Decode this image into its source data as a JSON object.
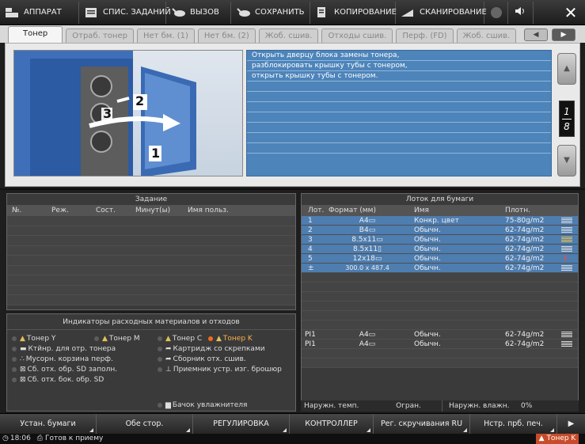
{
  "topbar": {
    "items": [
      {
        "label": "АППАРАТ",
        "icon": "machine-icon"
      },
      {
        "label": "СПИС. ЗАДАНИЙ",
        "icon": "list-icon"
      },
      {
        "label": "ВЫЗОВ",
        "icon": "recall-icon"
      },
      {
        "label": "СОХРАНИТЬ",
        "icon": "save-icon"
      },
      {
        "label": "КОПИРОВАНИЕ",
        "icon": "copy-icon"
      },
      {
        "label": "СКАНИРОВАНИЕ",
        "icon": "scan-icon"
      }
    ],
    "close_label": "✕"
  },
  "tabs": [
    "Тонер",
    "Отраб. тонер",
    "Нет бм. (1)",
    "Нет бм. (2)",
    "Жоб. сшив.",
    "Отходы сшив.",
    "Перф. (FD)",
    "Жоб. сшив."
  ],
  "illustration": {
    "label_1": "1",
    "label_2": "2",
    "label_3": "3"
  },
  "instructions": [
    "Открыть дверцу блока замены тонера,",
    "разблокировать крышку тубы с тонером,",
    "открыть крышку тубы с тонером."
  ],
  "page_indicator": {
    "current": "1",
    "total": "8"
  },
  "task": {
    "title": "Задание",
    "columns": [
      "№.",
      "Реж.",
      "Сост.",
      "Минут(ы)",
      "Имя польз."
    ]
  },
  "indicators": {
    "title": "Индикаторы расходных материалов и отходов",
    "items": [
      {
        "label": "Тонер Y",
        "active": false
      },
      {
        "label": "Тонер M",
        "active": false
      },
      {
        "label": "Тонер C",
        "active": false
      },
      {
        "label": "Тонер K",
        "active": true
      },
      {
        "label": "Ктйнр. для отр. тонера",
        "active": false
      },
      {
        "label": "Картридж со скрепками",
        "active": false
      },
      {
        "label": "Мусорн. корзина перф.",
        "active": false
      },
      {
        "label": "Сборник отх. сшив.",
        "active": false
      },
      {
        "label": "Сб. отх. обр. SD заполн.",
        "active": false
      },
      {
        "label": "Приемник устр. изг. брошюр",
        "active": false
      },
      {
        "label": "Сб. отх. бок. обр. SD",
        "active": false
      },
      {
        "label": "Бачок увлажнителя",
        "active": false
      }
    ]
  },
  "tray": {
    "title": "Лоток для бумаги",
    "columns": [
      "Лот.",
      "Формат (мм)",
      "Имя",
      "Плотн."
    ],
    "rows": [
      {
        "tray": "1",
        "size": "A4▭",
        "name": "Конкр. цвет",
        "weight": "75-80g/m2"
      },
      {
        "tray": "2",
        "size": "B4▭",
        "name": "Обычн.",
        "weight": "62-74g/m2"
      },
      {
        "tray": "3",
        "size": "8.5x11▭",
        "name": "Обычн.",
        "weight": "62-74g/m2"
      },
      {
        "tray": "4",
        "size": "8.5x11▯",
        "name": "Обычн.",
        "weight": "62-74g/m2"
      },
      {
        "tray": "5",
        "size": "12x18▭",
        "name": "Обычн.",
        "weight": "62-74g/m2"
      },
      {
        "tray": "±",
        "size": "300.0 x 487.4",
        "name": "Обычн.",
        "weight": "62-74g/m2"
      }
    ],
    "pi_rows": [
      {
        "tray": "PI1",
        "size": "A4▭",
        "name": "Обычн.",
        "weight": "62-74g/m2"
      },
      {
        "tray": "PI1",
        "size": "A4▭",
        "name": "Обычн.",
        "weight": "62-74g/m2"
      }
    ]
  },
  "status": {
    "temp_label": "Наружн. темп.",
    "temp_value": "Огран.",
    "hum_label": "Наружн. влажн.",
    "hum_value": "0%"
  },
  "bottom_buttons": [
    "Устан. бумаги",
    "Обе стор.",
    "РЕГУЛИРОВКА",
    "КОНТРОЛЛЕР",
    "Рег. скручивания RU",
    "Нстр. прб. печ."
  ],
  "footer": {
    "time": "18:06",
    "status": "Готов к приему",
    "warning": "Тонер K"
  }
}
